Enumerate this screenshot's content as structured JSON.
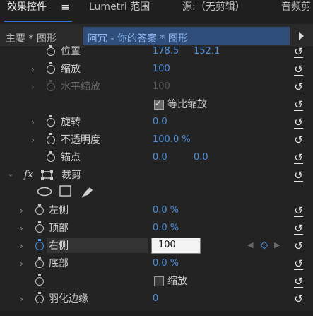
{
  "tabs": {
    "effects": "效果控件",
    "effects_menu": "≡",
    "lumetri": "Lumetri 范围",
    "source": "源:（无剪辑）",
    "audio": "音频剪"
  },
  "header": {
    "master": "主要 * 图形",
    "clip": "阿冗 - 你的答案 * 图形"
  },
  "rows": {
    "position": {
      "label": "位置",
      "x": "178.5",
      "y": "152.1"
    },
    "scale": {
      "label": "缩放",
      "value": "100"
    },
    "scale_width": {
      "label": "水平缩放",
      "value": "100"
    },
    "uniform_scale": {
      "label": "等比缩放"
    },
    "rotation": {
      "label": "旋转",
      "value": "0.0"
    },
    "opacity": {
      "label": "不透明度",
      "value": "100.0 %"
    },
    "anchor": {
      "label": "锚点",
      "x": "0.0",
      "y": "0.0"
    },
    "crop": {
      "fx": "fx",
      "label": "裁剪"
    },
    "left": {
      "label": "左侧",
      "value": "0.0 %"
    },
    "top": {
      "label": "顶部",
      "value": "0.0 %"
    },
    "right": {
      "label": "右侧",
      "value": "100"
    },
    "bottom": {
      "label": "底部",
      "value": "0.0 %"
    },
    "zoom": {
      "label": "缩放"
    },
    "feather": {
      "label": "羽化边缘",
      "value": "0"
    }
  },
  "icons": {
    "reset": "reset-icon",
    "stopwatch": "stopwatch-icon",
    "ellipse": "ellipse-mask-icon",
    "rect": "rectangle-mask-icon",
    "pen": "pen-mask-icon"
  },
  "colors": {
    "accent": "#4a8fe0",
    "background": "#232323",
    "clip_highlight": "#2f4e7a"
  }
}
